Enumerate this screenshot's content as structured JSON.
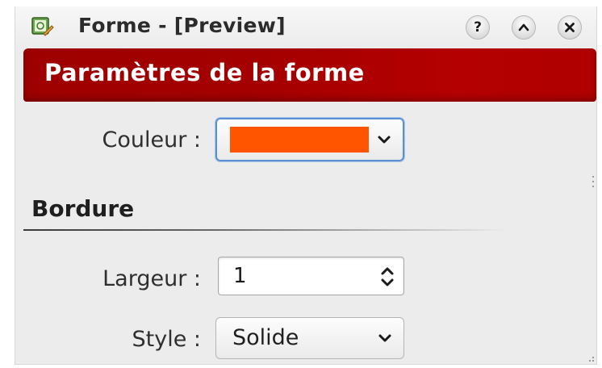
{
  "window": {
    "title": "Forme - [Preview]",
    "buttons": {
      "help": "?",
      "shade": "^",
      "close": "×"
    }
  },
  "banner": {
    "title": "Paramètres de la forme",
    "color": "#a80000"
  },
  "fields": {
    "couleur": {
      "label": "Couleur :",
      "value_color": "#ff5500"
    },
    "bordure": {
      "heading": "Bordure",
      "largeur": {
        "label": "Largeur :",
        "value": "1"
      },
      "style": {
        "label": "Style :",
        "value": "Solide"
      }
    }
  },
  "icons": {
    "app": "shape-app-icon",
    "help": "help-icon",
    "shade": "chevron-up-icon",
    "close": "close-icon",
    "dropdown": "chevron-down-icon",
    "spin": "spin-arrows-icon"
  },
  "colors": {
    "focus": "#5a8fd0"
  }
}
